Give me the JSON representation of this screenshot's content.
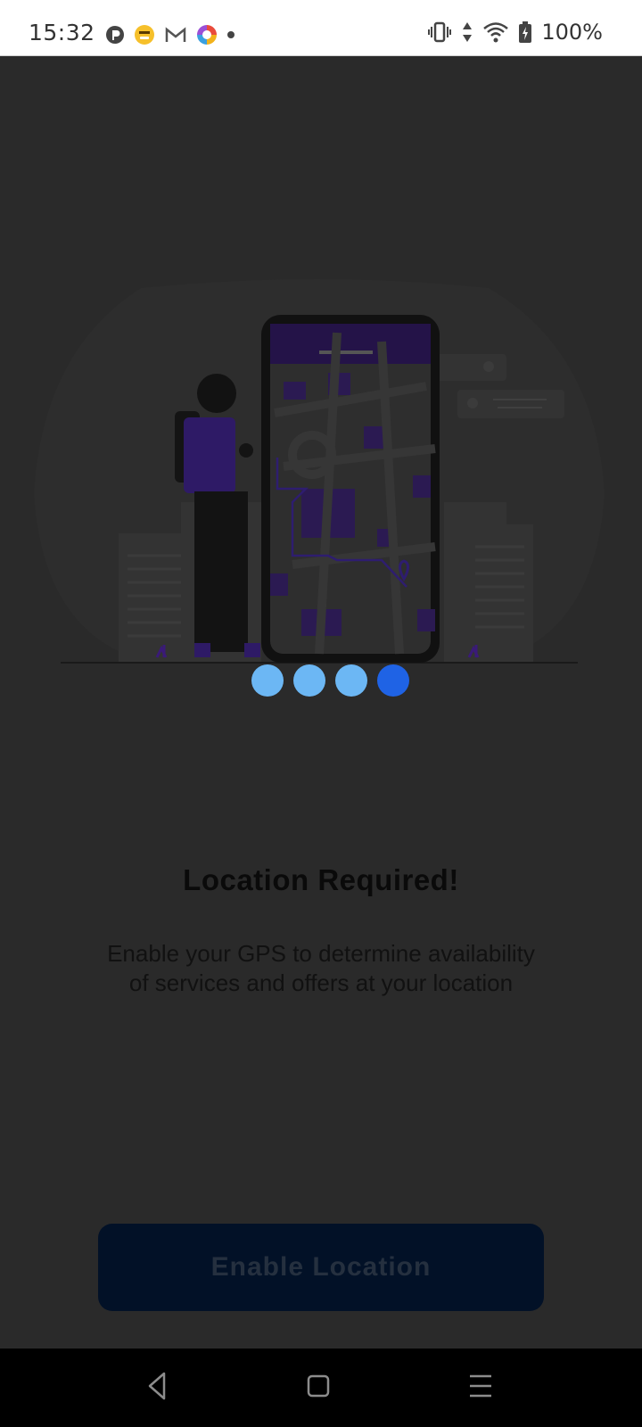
{
  "status_bar": {
    "time": "15:32",
    "battery": "100%",
    "left_icons": [
      "app-p-icon",
      "emoji-icon",
      "gmail-icon",
      "color-app-icon",
      "dot-icon"
    ],
    "right_icons": [
      "vibrate-icon",
      "data-arrows-icon",
      "wifi-icon",
      "battery-charging-icon"
    ]
  },
  "onboarding": {
    "page_count": 4,
    "active_page": 4,
    "title": "Location Required!",
    "description": "Enable your GPS to determine availability of services and offers at your location",
    "button_label": "Enable Location"
  },
  "colors": {
    "overlay": "#2a2a2a",
    "dot_inactive": "#6cb7f4",
    "dot_active": "#1f63e5",
    "button_bg": "#021127",
    "accent_purple": "#3a1a78"
  },
  "nav_bar": {
    "icons": [
      "back-icon",
      "home-icon",
      "recents-icon"
    ]
  }
}
